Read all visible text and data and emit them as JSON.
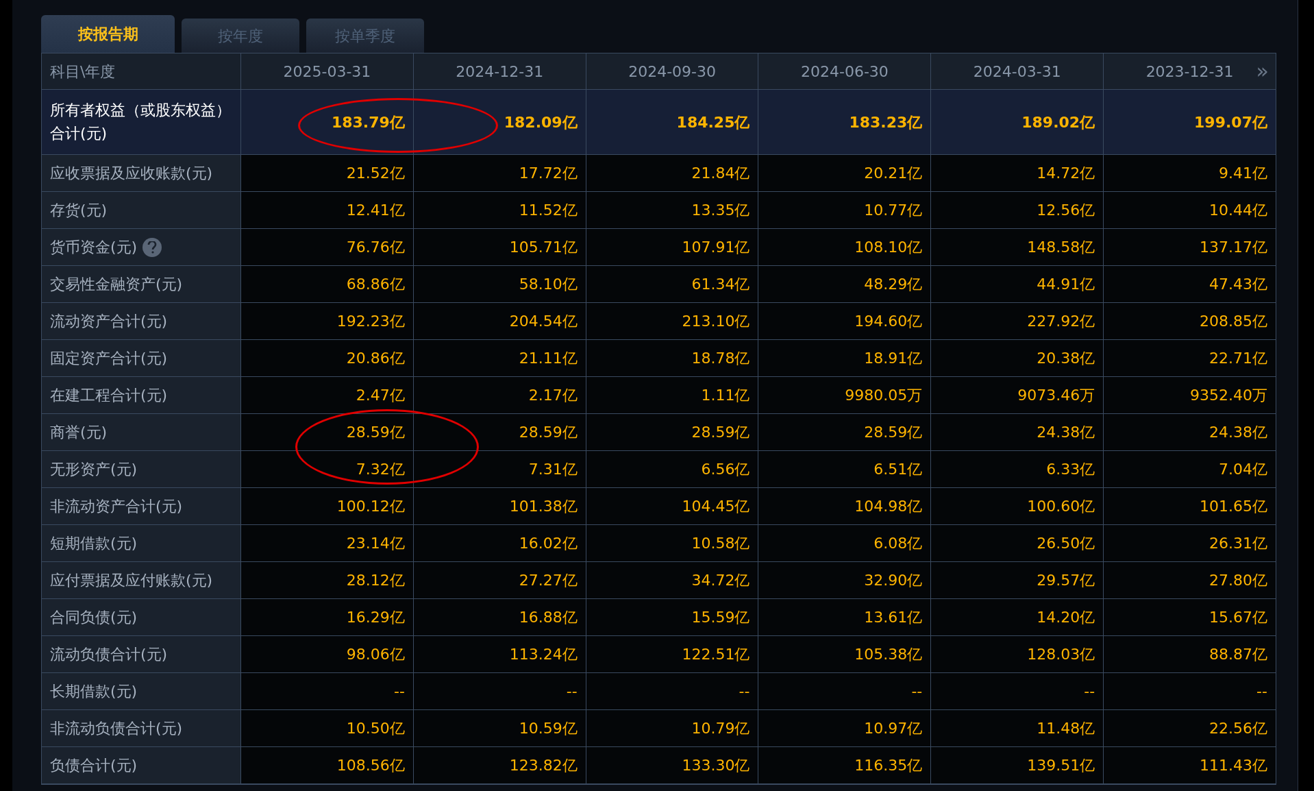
{
  "tabs": [
    {
      "label": "按报告期",
      "selected": true
    },
    {
      "label": "按年度",
      "selected": false
    },
    {
      "label": "按单季度",
      "selected": false
    }
  ],
  "table": {
    "corner": "科目\\年度",
    "columns": [
      "2025-03-31",
      "2024-12-31",
      "2024-09-30",
      "2024-06-30",
      "2024-03-31",
      "2023-12-31"
    ],
    "more": "»",
    "rows": [
      {
        "label": "所有者权益（或股东权益）合计(元)",
        "highlight": true,
        "help": false,
        "values": [
          "183.79亿",
          "182.09亿",
          "184.25亿",
          "183.23亿",
          "189.02亿",
          "199.07亿"
        ]
      },
      {
        "label": "应收票据及应收账款(元)",
        "highlight": false,
        "help": false,
        "values": [
          "21.52亿",
          "17.72亿",
          "21.84亿",
          "20.21亿",
          "14.72亿",
          "9.41亿"
        ]
      },
      {
        "label": "存货(元)",
        "highlight": false,
        "help": false,
        "values": [
          "12.41亿",
          "11.52亿",
          "13.35亿",
          "10.77亿",
          "12.56亿",
          "10.44亿"
        ]
      },
      {
        "label": "货币资金(元)",
        "highlight": false,
        "help": true,
        "values": [
          "76.76亿",
          "105.71亿",
          "107.91亿",
          "108.10亿",
          "148.58亿",
          "137.17亿"
        ]
      },
      {
        "label": "交易性金融资产(元)",
        "highlight": false,
        "help": false,
        "values": [
          "68.86亿",
          "58.10亿",
          "61.34亿",
          "48.29亿",
          "44.91亿",
          "47.43亿"
        ]
      },
      {
        "label": "流动资产合计(元)",
        "highlight": false,
        "help": false,
        "values": [
          "192.23亿",
          "204.54亿",
          "213.10亿",
          "194.60亿",
          "227.92亿",
          "208.85亿"
        ]
      },
      {
        "label": "固定资产合计(元)",
        "highlight": false,
        "help": false,
        "values": [
          "20.86亿",
          "21.11亿",
          "18.78亿",
          "18.91亿",
          "20.38亿",
          "22.71亿"
        ]
      },
      {
        "label": "在建工程合计(元)",
        "highlight": false,
        "help": false,
        "values": [
          "2.47亿",
          "2.17亿",
          "1.11亿",
          "9980.05万",
          "9073.46万",
          "9352.40万"
        ]
      },
      {
        "label": "商誉(元)",
        "highlight": false,
        "help": false,
        "values": [
          "28.59亿",
          "28.59亿",
          "28.59亿",
          "28.59亿",
          "24.38亿",
          "24.38亿"
        ]
      },
      {
        "label": "无形资产(元)",
        "highlight": false,
        "help": false,
        "values": [
          "7.32亿",
          "7.31亿",
          "6.56亿",
          "6.51亿",
          "6.33亿",
          "7.04亿"
        ]
      },
      {
        "label": "非流动资产合计(元)",
        "highlight": false,
        "help": false,
        "values": [
          "100.12亿",
          "101.38亿",
          "104.45亿",
          "104.98亿",
          "100.60亿",
          "101.65亿"
        ]
      },
      {
        "label": "短期借款(元)",
        "highlight": false,
        "help": false,
        "values": [
          "23.14亿",
          "16.02亿",
          "10.58亿",
          "6.08亿",
          "26.50亿",
          "26.31亿"
        ]
      },
      {
        "label": "应付票据及应付账款(元)",
        "highlight": false,
        "help": false,
        "values": [
          "28.12亿",
          "27.27亿",
          "34.72亿",
          "32.90亿",
          "29.57亿",
          "27.80亿"
        ]
      },
      {
        "label": "合同负债(元)",
        "highlight": false,
        "help": false,
        "values": [
          "16.29亿",
          "16.88亿",
          "15.59亿",
          "13.61亿",
          "14.20亿",
          "15.67亿"
        ]
      },
      {
        "label": "流动负债合计(元)",
        "highlight": false,
        "help": false,
        "values": [
          "98.06亿",
          "113.24亿",
          "122.51亿",
          "105.38亿",
          "128.03亿",
          "88.87亿"
        ]
      },
      {
        "label": "长期借款(元)",
        "highlight": false,
        "help": false,
        "values": [
          "--",
          "--",
          "--",
          "--",
          "--",
          "--"
        ]
      },
      {
        "label": "非流动负债合计(元)",
        "highlight": false,
        "help": false,
        "values": [
          "10.50亿",
          "10.59亿",
          "10.79亿",
          "10.97亿",
          "11.48亿",
          "22.56亿"
        ]
      },
      {
        "label": "负债合计(元)",
        "highlight": false,
        "help": false,
        "values": [
          "108.56亿",
          "123.82亿",
          "133.30亿",
          "116.35亿",
          "139.51亿",
          "111.43亿"
        ]
      }
    ]
  },
  "annotations": [
    {
      "kind": "ellipse"
    },
    {
      "kind": "ellipse"
    }
  ]
}
